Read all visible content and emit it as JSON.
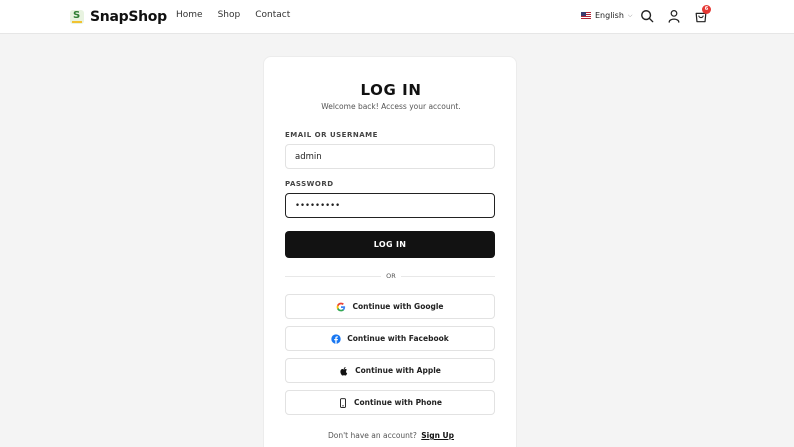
{
  "header": {
    "brand": "SnapShop",
    "brand_logo_letter": "S",
    "nav": [
      "Home",
      "Shop",
      "Contact"
    ],
    "language": "English",
    "cart_count": "6",
    "icons": [
      "search-icon",
      "user-icon",
      "shopping-bag-icon"
    ]
  },
  "login": {
    "title": "LOG IN",
    "subtitle": "Welcome back! Access your account.",
    "email_label": "EMAIL OR USERNAME",
    "email_value": "admin",
    "password_label": "PASSWORD",
    "password_value": "•••••••••",
    "submit_label": "LOG IN",
    "divider": "OR",
    "social": [
      {
        "label": "Continue with Google",
        "icon": "google-icon"
      },
      {
        "label": "Continue with Facebook",
        "icon": "facebook-icon"
      },
      {
        "label": "Continue with Apple",
        "icon": "apple-icon"
      },
      {
        "label": "Continue with Phone",
        "icon": "phone-icon"
      }
    ],
    "signup_prompt": "Don't have an account?",
    "signup_link": "Sign Up"
  },
  "colors": {
    "background": "#f4f4f4",
    "primary_button": "#121212",
    "badge": "#e53935",
    "facebook": "#1877f2"
  }
}
